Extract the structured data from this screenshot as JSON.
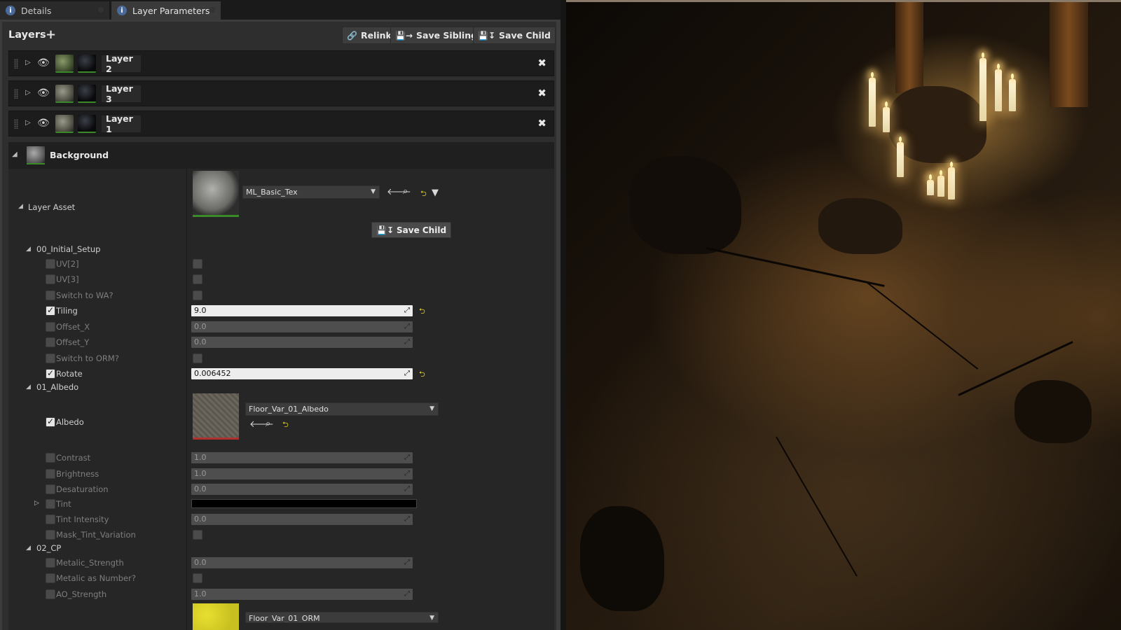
{
  "tabs": [
    {
      "label": "Details",
      "icon": "info-icon"
    },
    {
      "label": "Layer Parameters",
      "icon": "info-icon"
    }
  ],
  "layers_panel": {
    "title": "Layers",
    "toolbar": {
      "relink": "Relink",
      "save_sibling": "Save Sibling",
      "save_child": "Save Child"
    },
    "layers": [
      {
        "name": "Layer 2"
      },
      {
        "name": "Layer 3"
      },
      {
        "name": "Layer 1"
      }
    ],
    "background": {
      "name": "Background"
    }
  },
  "layer_asset": {
    "label": "Layer Asset",
    "asset_name": "ML_Basic_Tex",
    "save_child": "Save Child"
  },
  "groups": {
    "initial_setup": {
      "label": "00_Initial_Setup",
      "params": {
        "uv2": "UV[2]",
        "uv3": "UV[3]",
        "switch_wa": "Switch to WA?",
        "tiling": "Tiling",
        "tiling_value": "9.0",
        "offset_x": "Offset_X",
        "offset_x_value": "0.0",
        "offset_y": "Offset_Y",
        "offset_y_value": "0.0",
        "switch_orm": "Switch to ORM?",
        "rotate": "Rotate",
        "rotate_value": "0.006452"
      }
    },
    "albedo": {
      "label": "01_Albedo",
      "params": {
        "albedo": "Albedo",
        "albedo_texture": "Floor_Var_01_Albedo",
        "contrast": "Contrast",
        "contrast_value": "1.0",
        "brightness": "Brightness",
        "brightness_value": "1.0",
        "desaturation": "Desaturation",
        "desaturation_value": "0.0",
        "tint": "Tint",
        "tint_intensity": "Tint Intensity",
        "tint_intensity_value": "0.0",
        "mask_tint_variation": "Mask_Tint_Variation"
      }
    },
    "cp": {
      "label": "02_CP",
      "params": {
        "metalic_strength": "Metalic_Strength",
        "metalic_strength_value": "0.0",
        "metalic_as_number": "Metalic as Number?",
        "ao_strength": "AO_Strength",
        "ao_strength_value": "1.0",
        "orm_texture": "Floor_Var_01_ORM"
      }
    }
  },
  "colors": {
    "accent_green": "#3a8a2a",
    "reset_yellow": "#e0d020",
    "tint_color": "#000000"
  }
}
